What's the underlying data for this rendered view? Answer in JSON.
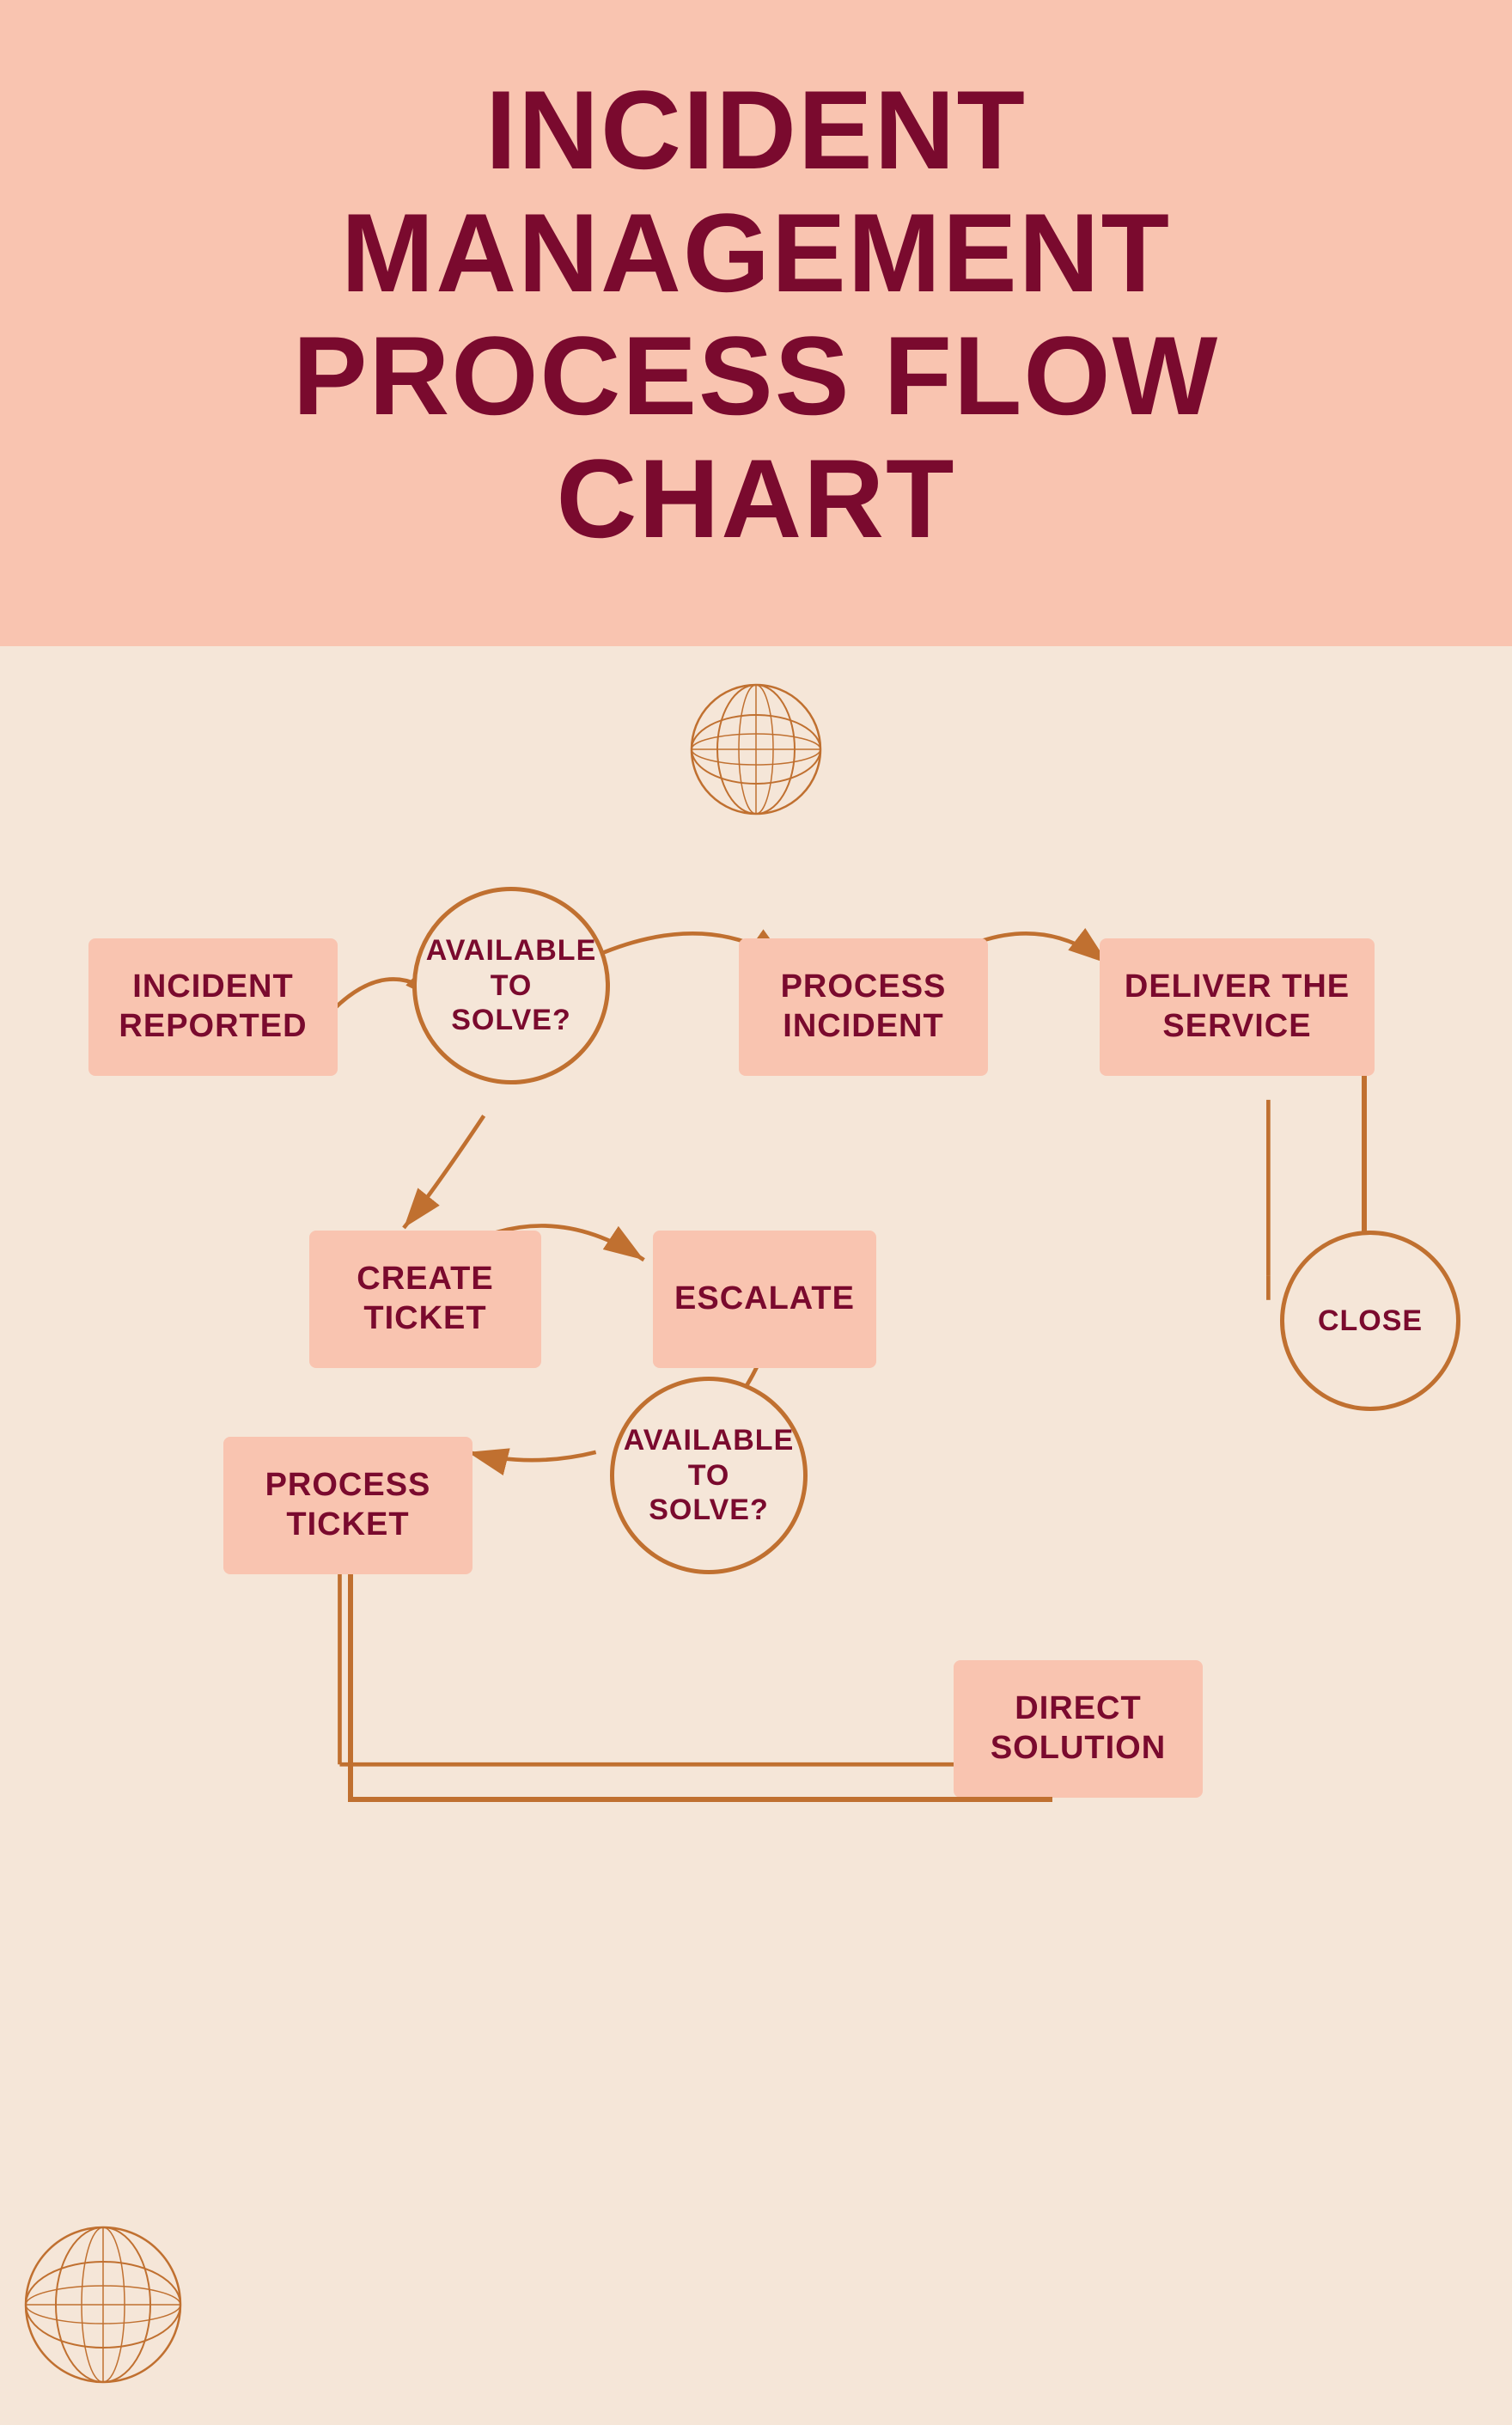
{
  "title": {
    "line1": "INCIDENT",
    "line2": "MANAGEMENT",
    "line3": "PROCESS FLOW",
    "line4": "CHART"
  },
  "nodes": {
    "incident_reported": "INCIDENT REPORTED",
    "available_to_solve_1": "AVAILABLE TO SOLVE?",
    "process_incident": "PROCESS INCIDENT",
    "deliver_the_service": "DELIVER THE SERVICE",
    "create_ticket": "CREATE TICKET",
    "escalate": "ESCALATE",
    "process_ticket": "PROCESS TICKET",
    "available_to_solve_2": "AVAILABLE TO SOLVE?",
    "close": "CLOSE",
    "direct_solution": "DIRECT SOLUTION"
  },
  "colors": {
    "title_bg": "#f9c4b0",
    "content_bg": "#f5e6d8",
    "box_bg": "#f9c4b0",
    "text_dark": "#7a0a2e",
    "arrow_color": "#c07030",
    "circle_border": "#c07030"
  }
}
